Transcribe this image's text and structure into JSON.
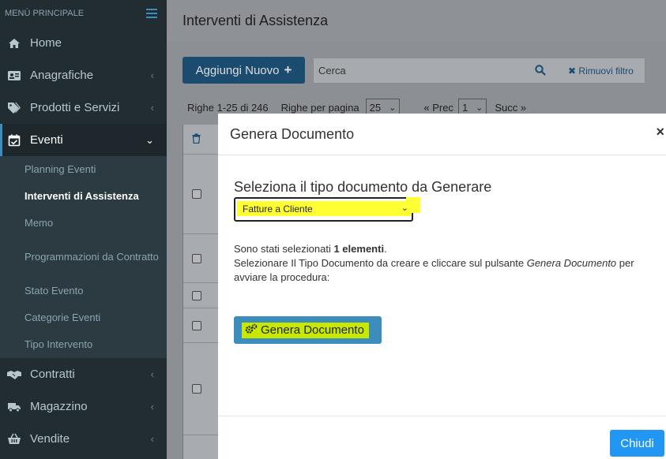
{
  "sidebar": {
    "header": "MENÙ PRINCIPALE",
    "items": [
      {
        "label": "Home",
        "icon": "home-icon"
      },
      {
        "label": "Anagrafiche",
        "icon": "id-card-icon"
      },
      {
        "label": "Prodotti e Servizi",
        "icon": "tags-icon"
      },
      {
        "label": "Eventi",
        "icon": "calendar-check-icon"
      },
      {
        "label": "Contratti",
        "icon": "handshake-icon"
      },
      {
        "label": "Magazzino",
        "icon": "truck-icon"
      },
      {
        "label": "Vendite",
        "icon": "basket-icon"
      }
    ],
    "subitems": [
      "Planning Eventi",
      "Interventi di Assistenza",
      "Memo",
      "Programmazioni da Contratto",
      "Stato Evento",
      "Categorie Eventi",
      "Tipo Intervento"
    ]
  },
  "main": {
    "title": "Interventi di Assistenza",
    "add_label": "Aggiungi Nuovo",
    "search_placeholder": "Cerca",
    "remove_filter": "Rimuovi filtro",
    "rows_info": "Righe 1-25 di 246",
    "rows_per_page_label": "Righe per pagina",
    "rows_per_page": "25",
    "prev": "« Prec",
    "page": "1",
    "next": "Succ »"
  },
  "modal": {
    "title": "Genera Documento",
    "select_label": "Seleziona il tipo documento da Generare",
    "select_value": "Fatture a Cliente",
    "info_prefix": "Sono stati selezionati ",
    "info_count": "1 elementi",
    "info_suffix": ".",
    "info_line2a": "Selezionare Il Tipo Documento da creare e cliccare sul pulsante ",
    "info_line2b": "Genera Documento",
    "info_line2c": " per avviare la procedura:",
    "generate_label": "Genera Documento",
    "close_label": "Chiudi",
    "close_x": "×"
  },
  "colors": {
    "sidebar_bg": "#222d32",
    "accent": "#3c8dbc",
    "highlight": "#ffff33",
    "close_button": "#2196f3"
  }
}
